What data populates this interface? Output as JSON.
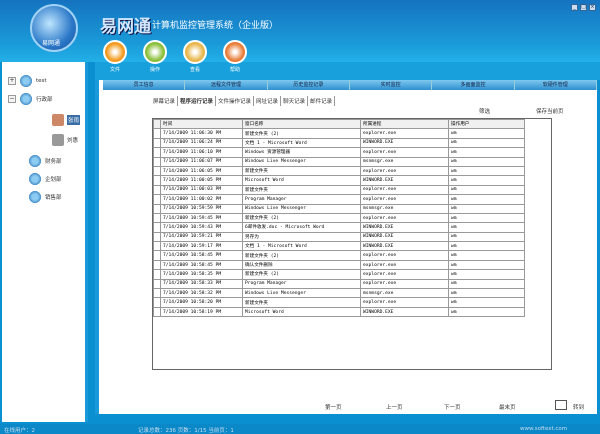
{
  "app": {
    "brand": "易网通",
    "subtitle": "计算机监控管理系统（企业版）",
    "logo_text": "易网通"
  },
  "toolbar": [
    {
      "label": "文件",
      "color": "#f39a1e"
    },
    {
      "label": "操作",
      "color": "#8bbf3a"
    },
    {
      "label": "查看",
      "color": "#e8b64a"
    },
    {
      "label": "帮助",
      "color": "#e87d3a"
    }
  ],
  "tree": {
    "root": "test",
    "dept1": "行政部",
    "user1": "张雨",
    "user2": "刘惠",
    "dept2": "财务部",
    "dept3": "企划部",
    "dept4": "销售部"
  },
  "tabs": [
    "员工信息",
    "远程文件管理",
    "历史监控记录",
    "实时监控",
    "多画面监控",
    "软硬件管理"
  ],
  "subtabs": [
    "屏幕记录",
    "程序运行记录",
    "文件操作记录",
    "网址记录",
    "聊天记录",
    "邮件记录"
  ],
  "filter_label": "筛选",
  "save_label": "保存当前页",
  "columns": [
    "时间",
    "窗口名称",
    "所属进程",
    "操作用户"
  ],
  "rows": [
    [
      "7/14/2009 11:06:30 PM",
      "新建文件夹 (2)",
      "explorer.exe",
      "wm"
    ],
    [
      "7/14/2009 11:06:24 PM",
      "文档 1 - Microsoft Word",
      "WINWORD.EXE",
      "wm"
    ],
    [
      "7/14/2009 11:06:10 PM",
      "Windows 资源管理器",
      "explorer.exe",
      "wm"
    ],
    [
      "7/14/2009 11:06:07 PM",
      "Windows Live Messenger",
      "msnmsgr.exe",
      "wm"
    ],
    [
      "7/14/2009 11:06:05 PM",
      "新建文件夹",
      "explorer.exe",
      "wm"
    ],
    [
      "7/14/2009 11:00:05 PM",
      "Microsoft Word",
      "WINWORD.EXE",
      "wm"
    ],
    [
      "7/14/2009 11:00:03 PM",
      "新建文件夹",
      "explorer.exe",
      "wm"
    ],
    [
      "7/14/2009 11:00:02 PM",
      "Program Manager",
      "explorer.exe",
      "wm"
    ],
    [
      "7/14/2009 10:59:59 PM",
      "Windows Live Messenger",
      "msnmsgr.exe",
      "wm"
    ],
    [
      "7/14/2009 10:59:45 PM",
      "新建文件夹 (2)",
      "explorer.exe",
      "wm"
    ],
    [
      "7/14/2009 10:59:43 PM",
      "6邮件收发.doc - Microsoft Word",
      "WINWORD.EXE",
      "wm"
    ],
    [
      "7/14/2009 10:59:21 PM",
      "另存为",
      "WINWORD.EXE",
      "wm"
    ],
    [
      "7/14/2009 10:59:17 PM",
      "文档 1 - Microsoft Word",
      "WINWORD.EXE",
      "wm"
    ],
    [
      "7/14/2009 10:58:45 PM",
      "新建文件夹 (2)",
      "explorer.exe",
      "wm"
    ],
    [
      "7/14/2009 10:58:45 PM",
      "确认文件删除",
      "explorer.exe",
      "wm"
    ],
    [
      "7/14/2009 10:58:35 PM",
      "新建文件夹 (2)",
      "explorer.exe",
      "wm"
    ],
    [
      "7/14/2009 10:58:33 PM",
      "Program Manager",
      "explorer.exe",
      "wm"
    ],
    [
      "7/14/2009 10:58:32 PM",
      "Windows Live Messenger",
      "msnmsgr.exe",
      "wm"
    ],
    [
      "7/14/2009 10:58:20 PM",
      "新建文件夹",
      "explorer.exe",
      "wm"
    ],
    [
      "7/14/2009 10:58:19 PM",
      "Microsoft Word",
      "WINWORD.EXE",
      "wm"
    ]
  ],
  "pager": {
    "first": "第一页",
    "prev": "上一页",
    "next": "下一页",
    "last": "最末页",
    "goto": "转到"
  },
  "status": {
    "online": "在线用户：2",
    "records": "记录总数：236  页数：1/15  当前页：1",
    "watermark": "www.softext.com"
  }
}
